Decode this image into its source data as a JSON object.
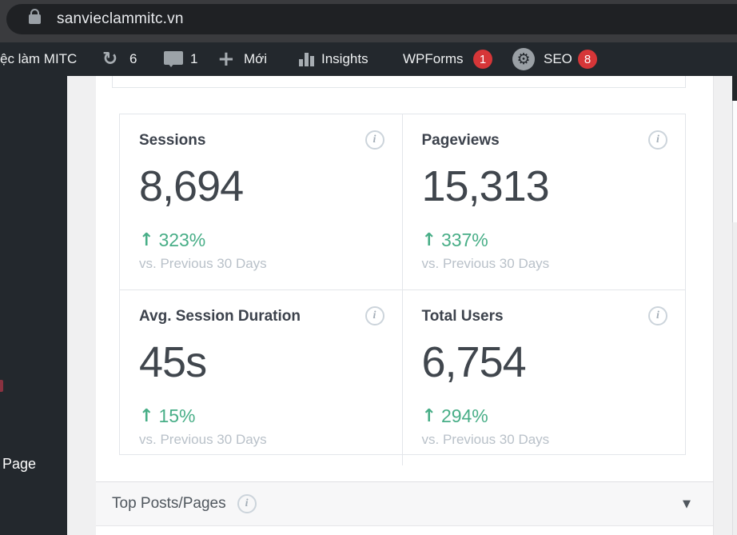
{
  "browser": {
    "url": "sanvieclammitc.vn"
  },
  "admin_bar": {
    "site_name": "ệc làm MITC",
    "updates_count": "6",
    "comments_count": "1",
    "new_label": "Mới",
    "insights_label": "Insights",
    "wpforms_label": "WPForms",
    "wpforms_badge": "1",
    "seo_label": "SEO",
    "seo_badge": "8"
  },
  "sidebar": {
    "visible_item_label": "Page"
  },
  "dashboard": {
    "cards": [
      {
        "title": "Sessions",
        "value": "8,694",
        "change": "323%",
        "compare": "vs. Previous 30 Days"
      },
      {
        "title": "Pageviews",
        "value": "15,313",
        "change": "337%",
        "compare": "vs. Previous 30 Days"
      },
      {
        "title": "Avg. Session Duration",
        "value": "45s",
        "change": "15%",
        "compare": "vs. Previous 30 Days"
      },
      {
        "title": "Total Users",
        "value": "6,754",
        "change": "294%",
        "compare": "vs. Previous 30 Days"
      }
    ],
    "section": {
      "title": "Top Posts/Pages"
    }
  },
  "icons": {
    "refresh": "↻",
    "plus": "+",
    "info": "i",
    "up_arrow": "↑",
    "caret": "▼",
    "gear": "⚙"
  },
  "colors": {
    "positive_green": "#48ae87",
    "badge_red": "#d63638",
    "admin_dark": "#23282d",
    "card_border": "#e3e6ea",
    "muted_text": "#b9c1c9"
  }
}
